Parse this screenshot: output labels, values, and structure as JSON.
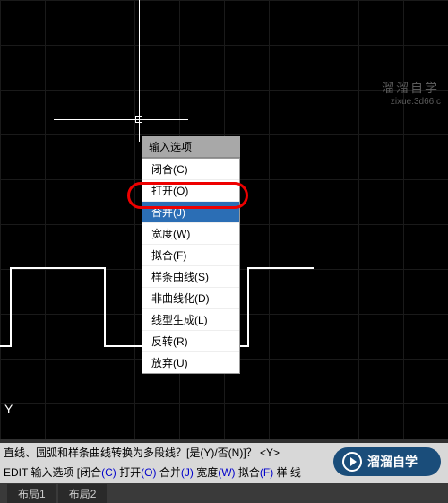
{
  "menu": {
    "header": "输入选项",
    "items": [
      {
        "label": "闭合(C)",
        "highlighted": false
      },
      {
        "label": "打开(O)",
        "highlighted": false
      },
      {
        "label": "合并(J)",
        "highlighted": true
      },
      {
        "label": "宽度(W)",
        "highlighted": false
      },
      {
        "label": "拟合(F)",
        "highlighted": false
      },
      {
        "label": "样条曲线(S)",
        "highlighted": false
      },
      {
        "label": "非曲线化(D)",
        "highlighted": false
      },
      {
        "label": "线型生成(L)",
        "highlighted": false
      },
      {
        "label": "反转(R)",
        "highlighted": false
      },
      {
        "label": "放弃(U)",
        "highlighted": false
      }
    ]
  },
  "canvas": {
    "y_label": "Y"
  },
  "watermark": {
    "line1": "溜溜自学",
    "line2": "zixue.3d66.c"
  },
  "command": {
    "line1": "直线、圆弧和样条曲线转换为多段线？[是(Y)/否(N)]？ <Y>",
    "line2_prefix": "EDIT 输入选项 [",
    "opts": [
      {
        "t": "闭合",
        "k": "(C)"
      },
      {
        "t": "打开",
        "k": "(O)"
      },
      {
        "t": "合并",
        "k": "(J)"
      },
      {
        "t": "宽度",
        "k": "(W)"
      },
      {
        "t": "拟合",
        "k": "(F)"
      },
      {
        "t": "样",
        "k": ""
      }
    ],
    "line2_suffix": "  线"
  },
  "tabs": {
    "left": "布局1",
    "right": "布局2"
  },
  "badge": {
    "text": "溜溜自学"
  }
}
